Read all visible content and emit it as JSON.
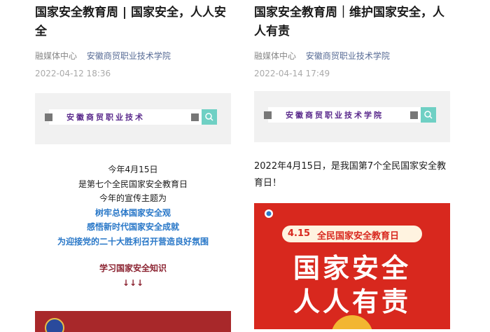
{
  "left": {
    "title": "国家安全教育周 | 国家安全，人人安全",
    "source": "融媒体中心",
    "account": "安徽商贸职业技术学院",
    "date": "2022-04-12 18:36",
    "banner_text": "安徽商贸职业技术",
    "lines": [
      "今年4月15日",
      "是第七个全民国家安全教育日",
      "今年的宣传主题为",
      "树牢总体国家安全观",
      "感悟新时代国家安全成就",
      "为迎接党的二十大胜利召开营造良好氛围"
    ],
    "cta": "学习国家安全知识",
    "arrows": "↓↓↓"
  },
  "right": {
    "title": "国家安全教育周｜维护国家安全，人人有责",
    "source": "融媒体中心",
    "account": "安徽商贸职业技术学院",
    "date": "2022-04-14 17:49",
    "banner_text": "安徽商贸职业技术学院",
    "body": "2022年4月15日，是我国第7个全民国家安全教育日！",
    "poster": {
      "date": "4.15",
      "label": "全民国家安全教育日",
      "line1": "国家安全",
      "line2": "人人有责"
    }
  },
  "colors": {
    "poster_red": "#d8281e",
    "link_blue": "#576b95",
    "highlight_blue": "#2a78c8"
  }
}
